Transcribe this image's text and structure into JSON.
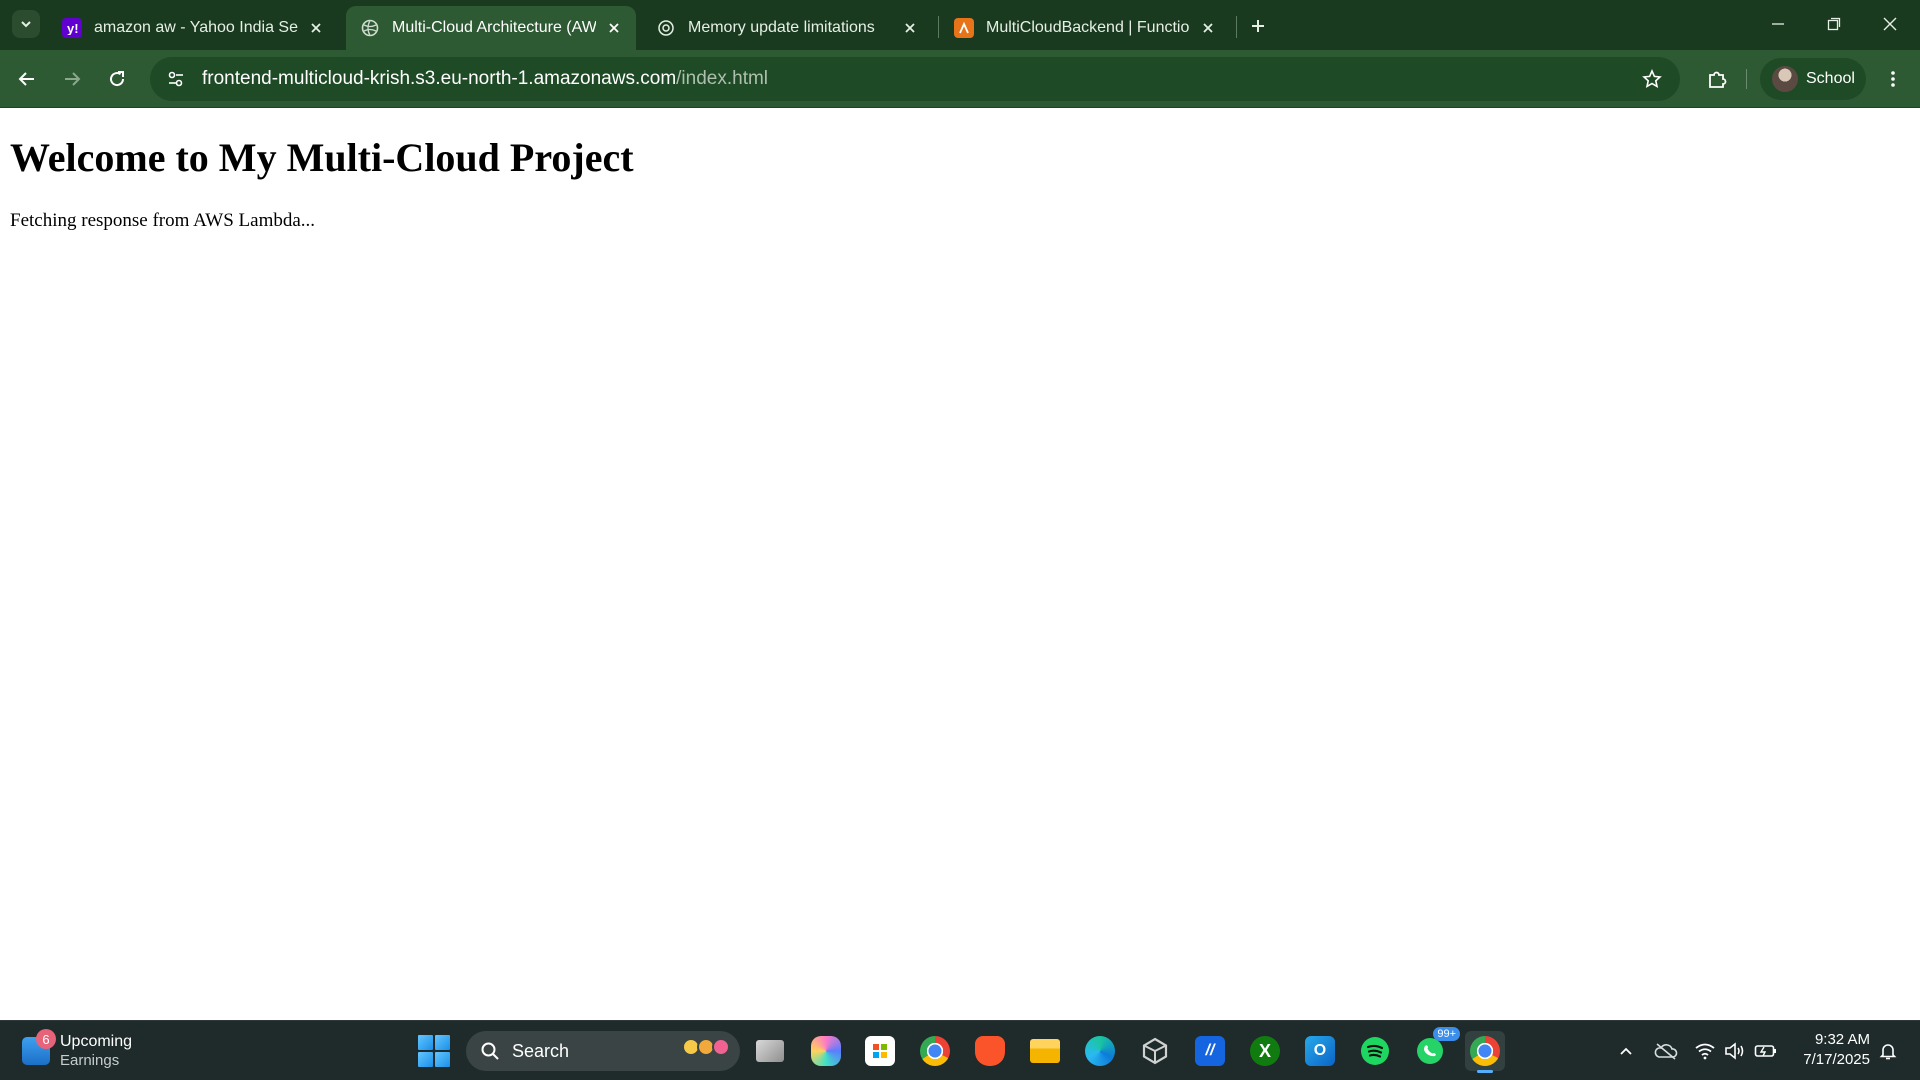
{
  "browser": {
    "tabs": [
      {
        "title": "amazon aw - Yahoo India Search",
        "favicon": "yahoo-icon",
        "active": false
      },
      {
        "title": "Multi-Cloud Architecture (AWS)",
        "favicon": "globe-icon",
        "active": true
      },
      {
        "title": "Memory update limitations",
        "favicon": "chatgpt-icon",
        "active": false
      },
      {
        "title": "MultiCloudBackend | Functions",
        "favicon": "aws-lambda-icon",
        "active": false
      }
    ],
    "url": {
      "host": "frontend-multicloud-krish.s3.eu-north-1.amazonaws.com",
      "path": "/index.html"
    },
    "profile_label": "School",
    "colors": {
      "frame": "#1a3a1f",
      "toolbar": "#2d5a32",
      "omnibox": "#1e4a26"
    }
  },
  "page": {
    "heading": "Welcome to My Multi-Cloud Project",
    "status_text": "Fetching response from AWS Lambda..."
  },
  "taskbar": {
    "widget": {
      "badge": "6",
      "title": "Upcoming",
      "subtitle": "Earnings"
    },
    "search_label": "Search",
    "apps": [
      "task-view-icon",
      "copilot-icon",
      "microsoft-store-icon",
      "chrome-icon",
      "brave-icon",
      "file-explorer-icon",
      "edge-icon",
      "unity-icon",
      "app-icon",
      "xbox-icon",
      "outlook-icon",
      "spotify-icon",
      "whatsapp-icon",
      "chrome-profile-icon"
    ],
    "whatsapp_badge": "99+",
    "clock": {
      "time": "9:32 AM",
      "date": "7/17/2025"
    }
  }
}
